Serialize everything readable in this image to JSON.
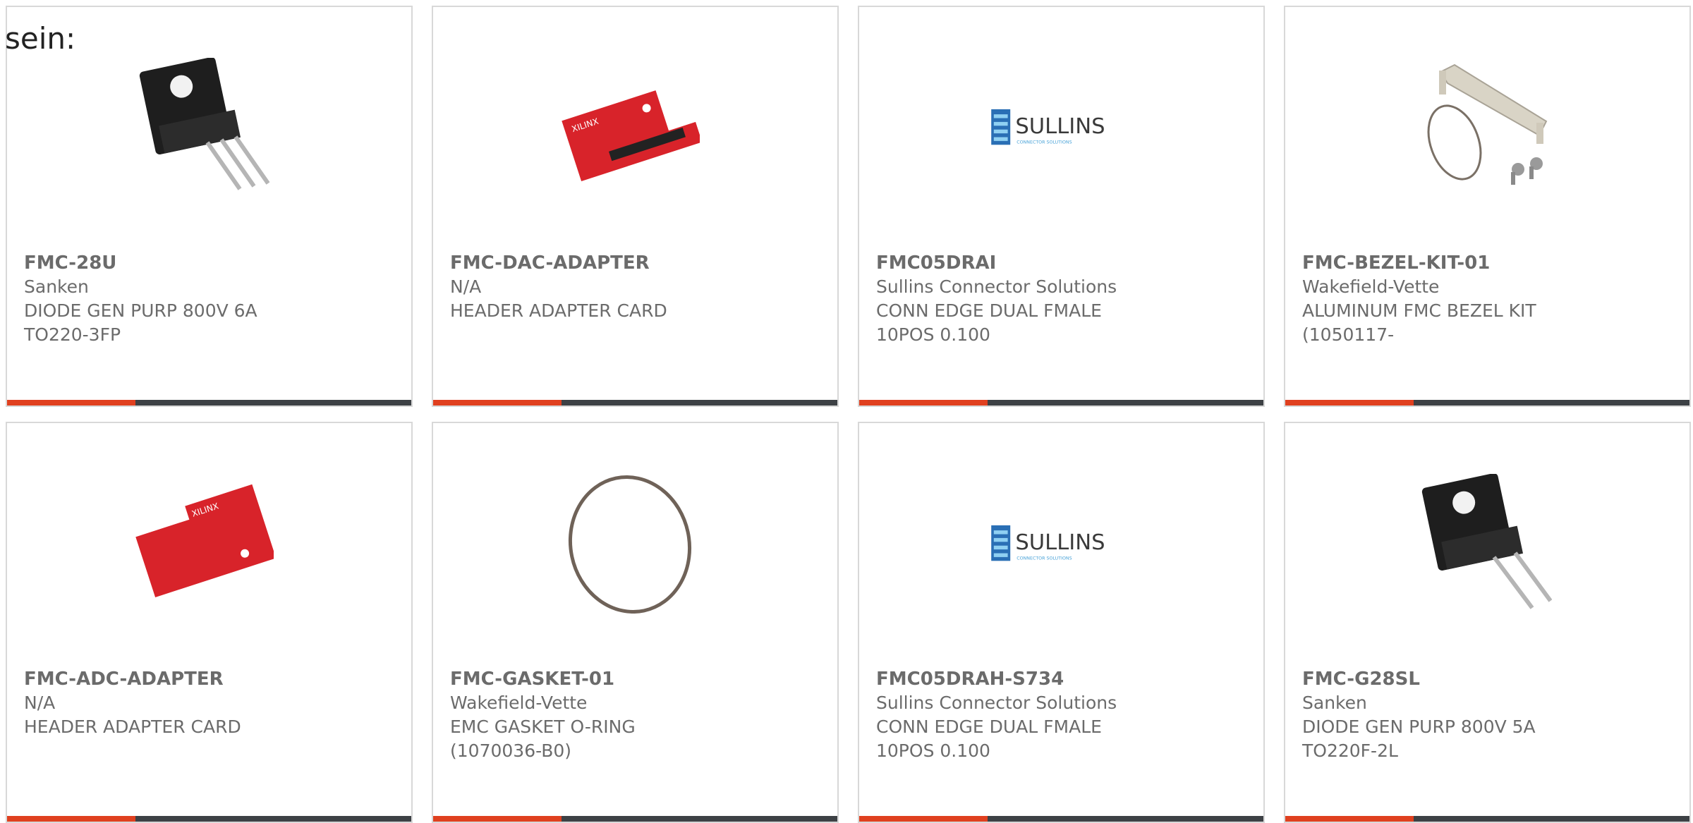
{
  "intro_text": "sein:",
  "colors": {
    "accent": "#e0401f",
    "bar": "#3d4145",
    "text": "#6b6b6b",
    "border": "#d8d8d8"
  },
  "products": [
    {
      "part": "FMC-28U",
      "maker": "Sanken",
      "description": "DIODE GEN PURP 800V 6A TO220-3FP",
      "image_icon": "transistor-3-lead-icon"
    },
    {
      "part": "FMC-DAC-ADAPTER",
      "maker": "N/A",
      "description": "HEADER ADAPTER CARD",
      "image_icon": "red-adapter-board-icon"
    },
    {
      "part": "FMC05DRAI",
      "maker": "Sullins Connector Solutions",
      "description": "CONN EDGE DUAL FMALE 10POS 0.100",
      "image_icon": "sullins-logo-icon"
    },
    {
      "part": "FMC-BEZEL-KIT-01",
      "maker": "Wakefield-Vette",
      "description": "ALUMINUM FMC BEZEL KIT (1050117-",
      "image_icon": "bezel-kit-icon"
    },
    {
      "part": "FMC-ADC-ADAPTER",
      "maker": "N/A",
      "description": "HEADER ADAPTER CARD",
      "image_icon": "red-adapter-board-icon"
    },
    {
      "part": "FMC-GASKET-01",
      "maker": "Wakefield-Vette",
      "description": "EMC GASKET O-RING (1070036-B0)",
      "image_icon": "o-ring-icon"
    },
    {
      "part": "FMC05DRAH-S734",
      "maker": "Sullins Connector Solutions",
      "description": "CONN EDGE DUAL FMALE 10POS 0.100",
      "image_icon": "sullins-logo-icon"
    },
    {
      "part": "FMC-G28SL",
      "maker": "Sanken",
      "description": "DIODE GEN PURP 800V 5A TO220F-2L",
      "image_icon": "transistor-2-lead-icon"
    }
  ],
  "logos": {
    "sullins_name": "SULLINS",
    "sullins_tagline": "CONNECTOR SOLUTIONS",
    "xilinx_name": "XILINX"
  }
}
